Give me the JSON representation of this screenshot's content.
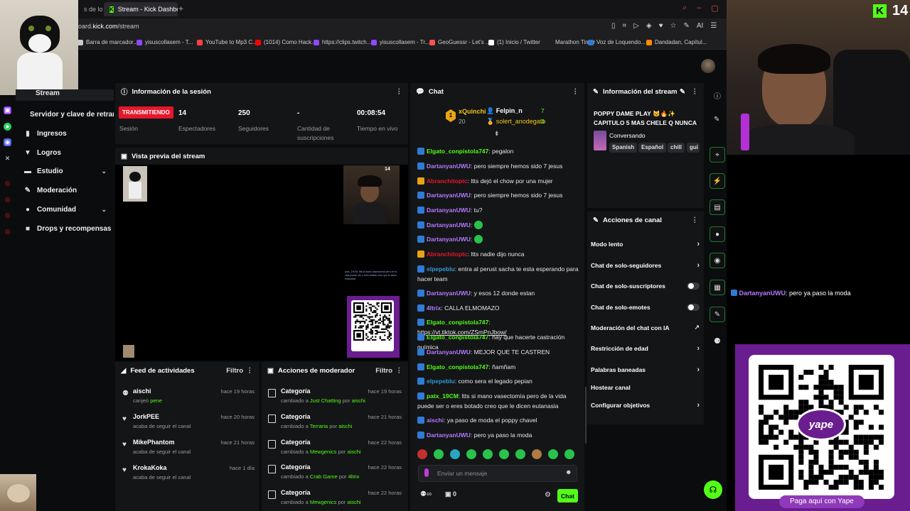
{
  "browser": {
    "tab_prev_label": "s de los M",
    "tab_active_label": "Stream - Kick Dashboard",
    "new_tab": "+",
    "url_host": "oard.",
    "url_bold": "kick.com",
    "url_path": "/stream",
    "ext_ai": "AI",
    "bookmarks": [
      {
        "label": "Barra de marcador...",
        "color": "#c9c9c9"
      },
      {
        "label": "yisuscollasem - T...",
        "color": "#9146ff"
      },
      {
        "label": "YouTube to Mp3 C...",
        "color": "#ff4040"
      },
      {
        "label": "(1014) Como Hack...",
        "color": "#ff0000"
      },
      {
        "label": "https://clips.twitch...",
        "color": "#9146ff"
      },
      {
        "label": "yisuscollasem - Tr...",
        "color": "#9146ff"
      },
      {
        "label": "GeoGuessr - Let's ...",
        "color": "#ff5050"
      },
      {
        "label": "(1) Inicio / Twitter",
        "color": "#ffffff"
      },
      {
        "label": "Marathon Timer",
        "color": "#1e1e21"
      },
      {
        "label": "Voz de Loquendo...",
        "color": "#2f7bd6"
      },
      {
        "label": "Dandadan, Capítul...",
        "color": "#ff8a00"
      }
    ]
  },
  "sidebar": {
    "stream_item": "Stream",
    "items": [
      {
        "label": "Servidor y clave de retransm"
      },
      {
        "label": "Ingresos"
      },
      {
        "label": "Logros"
      },
      {
        "label": "Estudio"
      },
      {
        "label": "Moderación"
      },
      {
        "label": "Comunidad"
      },
      {
        "label": "Drops y recompensas"
      }
    ]
  },
  "session": {
    "title": "Información de la sesión",
    "status": "TRANSMITIENDO",
    "status_label": "Sesión",
    "viewers": "14",
    "viewers_label": "Espectadores",
    "followers": "250",
    "followers_label": "Seguidores",
    "subs": "-",
    "subs_label": "Cantidad de suscripciones",
    "time": "00:08:54",
    "time_label": "Tiempo en vivo"
  },
  "preview": {
    "title": "Vista previa del stream",
    "cam_count": "14",
    "overlay_text": "patx_19CM: Itts si mano vasectomía pero de la vida puede ser o eres botado creo que le dicen eutanasia"
  },
  "feed": {
    "title": "Feed de actividades",
    "filter": "Filtro",
    "items": [
      {
        "name": "aischi",
        "sub": "canjeó ",
        "sub_hl": "pene",
        "time": "hace 19 horas"
      },
      {
        "name": "JorkPEE",
        "sub": "acaba de seguir el canal",
        "sub_hl": "",
        "time": "hace 20 horas"
      },
      {
        "name": "MikePhantom",
        "sub": "acaba de seguir el canal",
        "sub_hl": "",
        "time": "hace 21 horas"
      },
      {
        "name": "KrokaKoka",
        "sub": "acaba de seguir el canal",
        "sub_hl": "",
        "time": "hace 1 día"
      }
    ]
  },
  "mod": {
    "title": "Acciones de moderador",
    "filter": "Filtro",
    "items": [
      {
        "name": "Categoría",
        "pre": "cambiado a ",
        "cat": "Just Chatting",
        "mid": " por ",
        "by": "aischi",
        "time": "hace 19 horas"
      },
      {
        "name": "Categoría",
        "pre": "cambiado a ",
        "cat": "Terraria",
        "mid": " por ",
        "by": "aischi",
        "time": "hace 21 horas"
      },
      {
        "name": "Categoría",
        "pre": "cambiado a ",
        "cat": "Mewgenics",
        "mid": " por ",
        "by": "aischi",
        "time": "hace 22 horas"
      },
      {
        "name": "Categoría",
        "pre": "cambiado a ",
        "cat": "Crab Game",
        "mid": " por ",
        "by": "4ltrix",
        "time": "hace 22 horas"
      },
      {
        "name": "Categoría",
        "pre": "cambiado a ",
        "cat": "Mewgenics",
        "mid": " por ",
        "by": "aischi",
        "time": "hace 22 horas"
      }
    ]
  },
  "chat": {
    "title": "Chat",
    "leaderboard": [
      {
        "rank": "1",
        "name": "xQuinchi",
        "value": "20"
      },
      {
        "name": "Felpin_n",
        "value": "7"
      },
      {
        "name": "solert_anodegato",
        "value": "3"
      }
    ],
    "messages": [
      {
        "user": "Elgato_conpistola747",
        "color": "#53fc18",
        "text": "pegalon"
      },
      {
        "user": "DartanyanUWU",
        "color": "#b47aff",
        "text": "pero siempre hemos sido 7 jesus"
      },
      {
        "user": "Abranchitoptc",
        "color": "#e5172a",
        "text": "ltts dejó el chow por una mujer"
      },
      {
        "user": "DartanyanUWU",
        "color": "#b47aff",
        "text": "pero siempre hemos sido 7 jesus"
      },
      {
        "user": "DartanyanUWU",
        "color": "#b47aff",
        "text": "tu?"
      },
      {
        "user": "DartanyanUWU",
        "color": "#b47aff",
        "text": ""
      },
      {
        "user": "DartanyanUWU",
        "color": "#b47aff",
        "text": ""
      },
      {
        "user": "Abranchitoptc",
        "color": "#e5172a",
        "text": "ltts nadie dijo nunca"
      },
      {
        "user": "elpepeblu",
        "color": "#2f9bd6",
        "text": "entra al perust sacha te esta esperando para hacer team"
      },
      {
        "user": "DartanyanUWU",
        "color": "#b47aff",
        "text": "y esos 12 donde estan"
      },
      {
        "user": "4ltrix",
        "color": "#b47aff",
        "text": "CALLA ELMOMAZO"
      },
      {
        "user": "Elgato_conpistola747",
        "color": "#53fc18",
        "text": "https://vt.tiktok.com/ZSmPnJbow/"
      },
      {
        "user": "Elgato_conpistola747",
        "color": "#53fc18",
        "text": "hay que hacerte castración química"
      },
      {
        "user": "DartanyanUWU",
        "color": "#b47aff",
        "text": "MEJOR QUE TE CASTREN"
      },
      {
        "user": "Elgato_conpistola747",
        "color": "#53fc18",
        "text": "ñamñam"
      },
      {
        "user": "elpepeblu",
        "color": "#2f9bd6",
        "text": "como sera el legado pepian"
      },
      {
        "user": "patx_19CM",
        "color": "#53fc18",
        "text": "ltts si mano vasectomía pero de la vida puede ser o eres botado creo que le dicen eutanasia"
      },
      {
        "user": "aischi",
        "color": "#b47aff",
        "text": "ya paso de moda el poppy chavel"
      },
      {
        "user": "DartanyanUWU",
        "color": "#b47aff",
        "text": "pero ya paso la moda"
      }
    ],
    "placeholder": "Enviar un mensaje",
    "points": "∞",
    "count": "0",
    "send_label": "Chat"
  },
  "stream_info": {
    "title": "Información del stream",
    "stream_title": "POPPY DAME PLAY 🐱🔥✨ CAPITULO 5 MAS CHELE Q NUNCA",
    "category": "Conversando",
    "tags": [
      "Spanish",
      "Español",
      "chill",
      "gui"
    ]
  },
  "channel_actions": {
    "title": "Acciones de canal",
    "items": [
      {
        "label": "Modo lento",
        "kind": "chevron"
      },
      {
        "label": "Chat de solo-seguidores",
        "kind": "chevron"
      },
      {
        "label": "Chat de solo-suscriptores",
        "kind": "toggle"
      },
      {
        "label": "Chat de solo-emotes",
        "kind": "toggle"
      },
      {
        "label": "Moderación del chat con IA",
        "kind": "external"
      },
      {
        "label": "Restricción de edad",
        "kind": "chevron"
      },
      {
        "label": "Palabras baneadas",
        "kind": "chevron"
      },
      {
        "label": "Hostear canal",
        "kind": "none"
      },
      {
        "label": "Configurar objetivos",
        "kind": "chevron"
      }
    ]
  },
  "overlay": {
    "kick_count": "14",
    "chat_user": "DartanyanUWU",
    "chat_text": ": pero ya paso la moda",
    "yape_label": "Paga aquí con Yape",
    "yape_logo": "yape"
  }
}
